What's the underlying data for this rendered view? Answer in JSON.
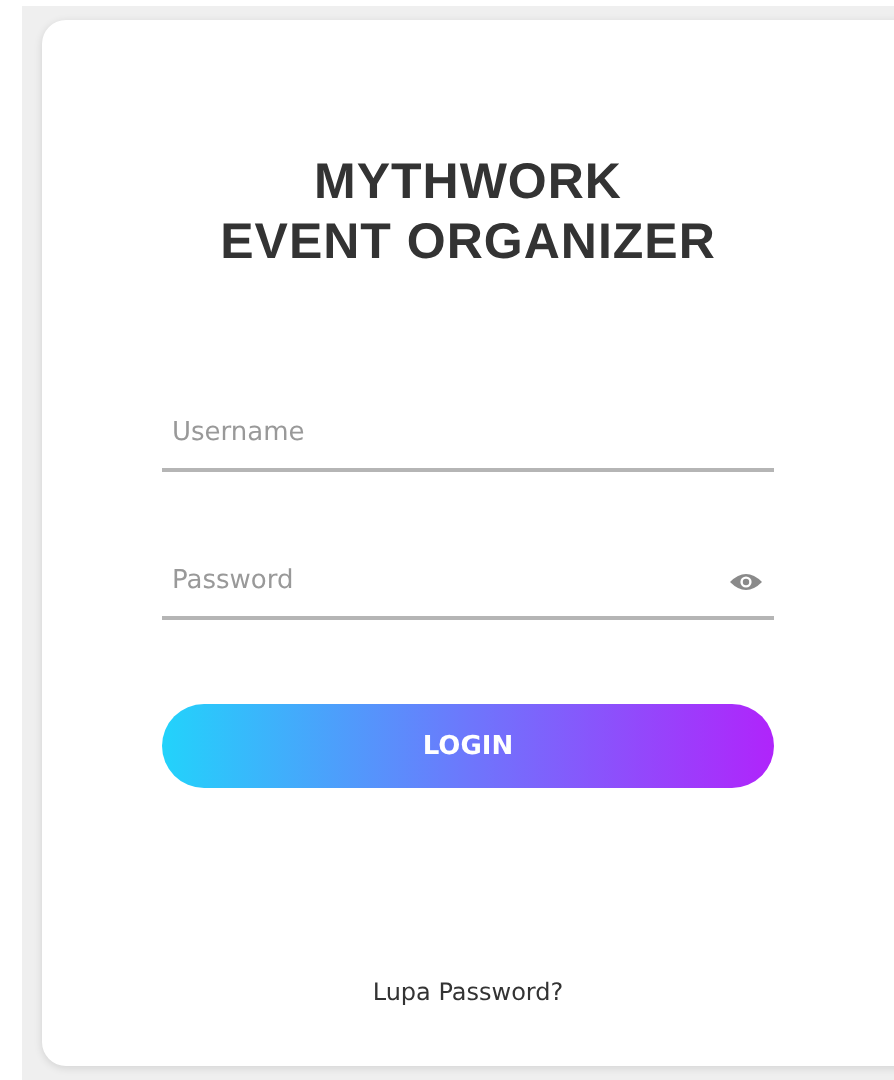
{
  "title_lines": [
    "MYTHWORK",
    "EVENT ORGANIZER"
  ],
  "fields": [
    {
      "kind": "text",
      "placeholder": "Username"
    },
    {
      "kind": "password",
      "placeholder": "Password"
    }
  ],
  "login_button": "LOGIN",
  "forgot_link": "Lupa Password?"
}
